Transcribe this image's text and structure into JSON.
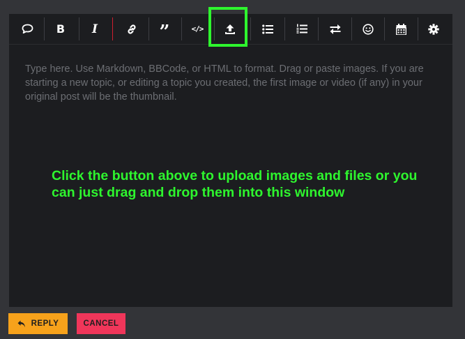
{
  "toolbar": {
    "buttons": [
      {
        "name": "speech-bubble-icon"
      },
      {
        "name": "bold-icon",
        "glyph": "B"
      },
      {
        "name": "italic-icon",
        "glyph": "I"
      },
      {
        "name": "link-icon"
      },
      {
        "name": "quote-icon",
        "glyph": "”"
      },
      {
        "name": "code-icon",
        "glyph": "</>"
      },
      {
        "name": "upload-icon"
      },
      {
        "name": "bulleted-list-icon"
      },
      {
        "name": "numbered-list-icon"
      },
      {
        "name": "swap-arrows-icon"
      },
      {
        "name": "emoji-icon"
      },
      {
        "name": "calendar-icon"
      },
      {
        "name": "gear-icon"
      }
    ],
    "highlight_color": "#2ef52e"
  },
  "editor": {
    "placeholder": "Type here. Use Markdown, BBCode, or HTML to format. Drag or paste images. If you are starting a new topic, or editing a topic you created, the first image or video (if any) in your original post will be the thumbnail."
  },
  "annotation": {
    "text": "Click the button above to upload images and files or you can just drag and drop them into this window",
    "color": "#2ef52e"
  },
  "actions": {
    "reply_label": "REPLY",
    "reply_icon": "reply-arrow-icon",
    "cancel_label": "CANCEL",
    "reply_color": "#f7a21b",
    "cancel_color": "#f0365a"
  }
}
